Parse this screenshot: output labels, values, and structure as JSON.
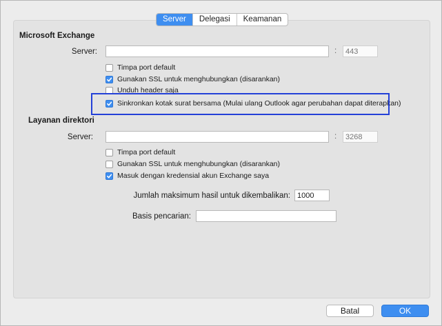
{
  "tabs": [
    "Server",
    "Delegasi",
    "Keamanan"
  ],
  "exchange": {
    "heading": "Microsoft Exchange",
    "server_label": "Server:",
    "server_value": "",
    "port_colon": ":",
    "port_placeholder": "443",
    "chk_override_port": "Timpa port default",
    "chk_ssl": "Gunakan SSL untuk menghubungkan (disarankan)",
    "chk_headers": "Unduh header saja",
    "chk_sync_shared": "Sinkronkan kotak surat bersama (Mulai ulang Outlook agar perubahan dapat diterapkan)"
  },
  "directory": {
    "heading": "Layanan direktori",
    "server_label": "Server:",
    "server_value": "",
    "port_colon": ":",
    "port_placeholder": "3268",
    "chk_override_port": "Timpa port default",
    "chk_ssl": "Gunakan SSL untuk menghubungkan (disarankan)",
    "chk_login": "Masuk dengan kredensial akun Exchange saya",
    "max_results_label": "Jumlah maksimum hasil untuk dikembalikan:",
    "max_results_value": "1000",
    "search_base_label": "Basis pencarian:",
    "search_base_value": ""
  },
  "checked": {
    "ex_override_port": false,
    "ex_ssl": true,
    "ex_headers": false,
    "ex_sync_shared": true,
    "dir_override_port": false,
    "dir_ssl": false,
    "dir_login": true
  },
  "buttons": {
    "cancel": "Batal",
    "ok": "OK"
  },
  "colors": {
    "accent": "#3e8ef0",
    "highlight_border": "#2340d8"
  }
}
